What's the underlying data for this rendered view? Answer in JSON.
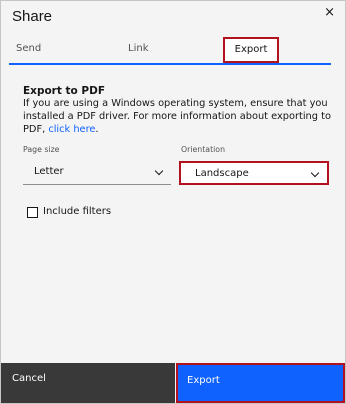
{
  "dialog": {
    "title": "Share",
    "close_symbol": "×"
  },
  "tabs": [
    {
      "label": "Send",
      "selected": false
    },
    {
      "label": "Link",
      "selected": false
    },
    {
      "label": "Export",
      "selected": true
    }
  ],
  "export": {
    "section_title": "Export to PDF",
    "description": "If you are using a Windows operating system, ensure that you installed a PDF driver. For more information about exporting to PDF, ",
    "link_text": "click here",
    "after_link": "."
  },
  "page_size": {
    "label": "Page size",
    "value": "Letter"
  },
  "orientation": {
    "label": "Orientation",
    "value": "Landscape"
  },
  "include_filters": {
    "label": "Include filters",
    "checked": false
  },
  "footer": {
    "cancel_label": "Cancel",
    "export_label": "Export"
  },
  "colors": {
    "primary": "#0f62fe",
    "highlight": "#b1121d",
    "secondary": "#393939"
  },
  "icons": {
    "close": "close-icon",
    "chevron": "chevron-down-icon",
    "checkbox": "checkbox-icon"
  }
}
